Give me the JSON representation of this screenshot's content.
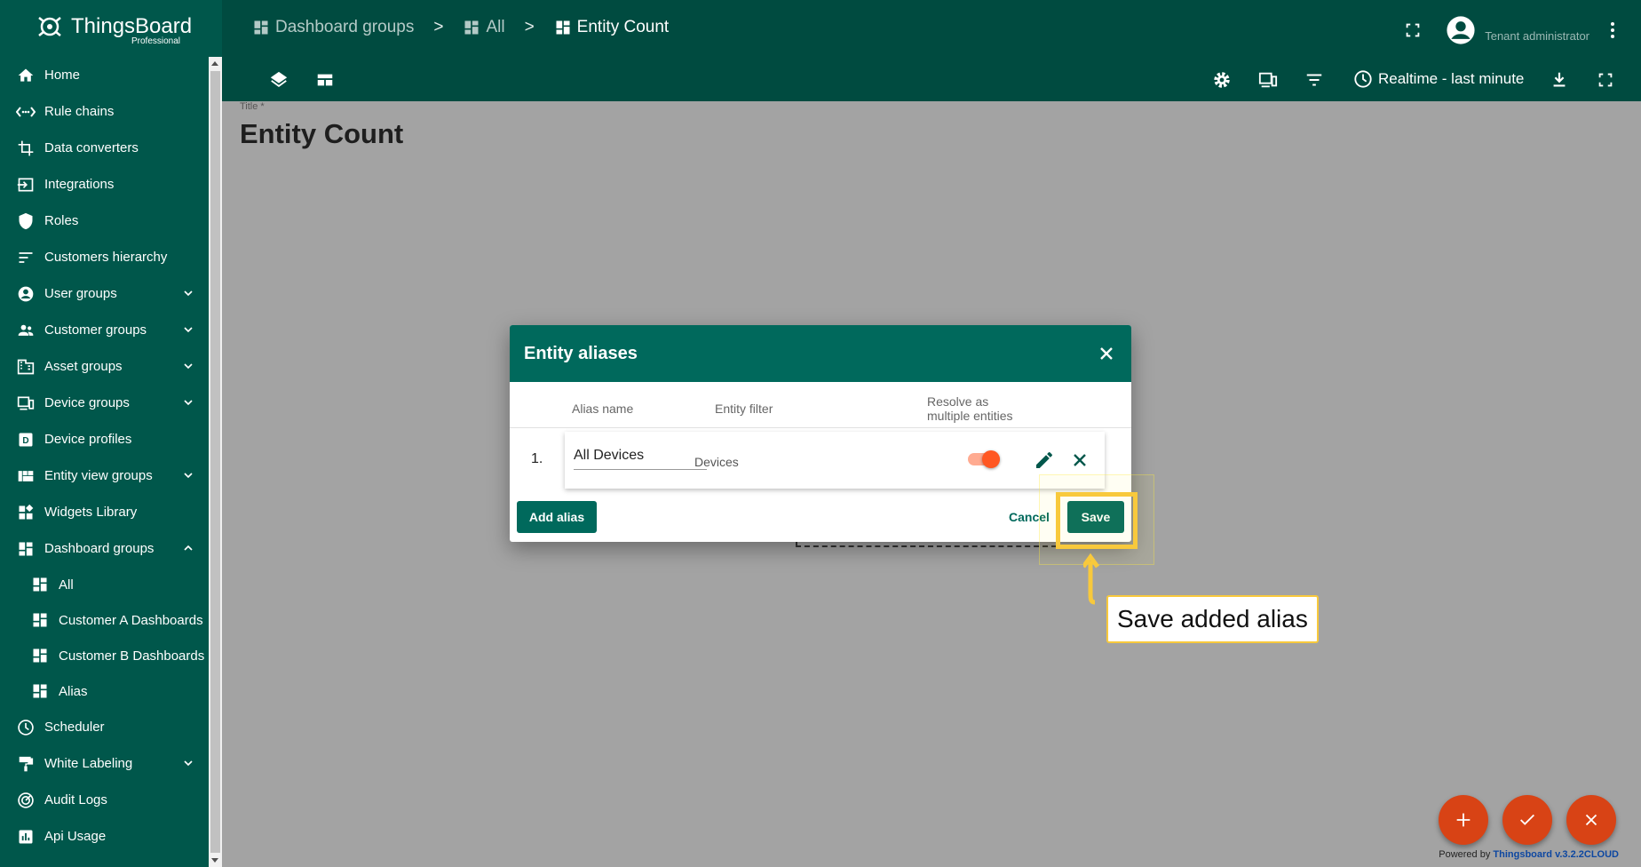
{
  "app": {
    "logo_title": "ThingsBoard",
    "logo_subtitle": "Professional"
  },
  "sidebar": {
    "items": [
      {
        "label": "Home",
        "icon": "home-icon"
      },
      {
        "label": "Rule chains",
        "icon": "rule-chain-icon"
      },
      {
        "label": "Data converters",
        "icon": "converter-icon"
      },
      {
        "label": "Integrations",
        "icon": "integration-icon"
      },
      {
        "label": "Roles",
        "icon": "shield-icon"
      },
      {
        "label": "Customers hierarchy",
        "icon": "hierarchy-icon"
      },
      {
        "label": "User groups",
        "icon": "account-icon"
      },
      {
        "label": "Customer groups",
        "icon": "people-icon"
      },
      {
        "label": "Asset groups",
        "icon": "domain-icon"
      },
      {
        "label": "Device groups",
        "icon": "devices-icon"
      },
      {
        "label": "Device profiles",
        "icon": "device-profile-icon"
      },
      {
        "label": "Entity view groups",
        "icon": "view-quilt-icon"
      },
      {
        "label": "Widgets Library",
        "icon": "widgets-icon"
      },
      {
        "label": "Dashboard groups",
        "icon": "dashboard-icon"
      },
      {
        "label": "All",
        "icon": "dashboard-icon"
      },
      {
        "label": "Customer A Dashboards",
        "icon": "dashboard-icon"
      },
      {
        "label": "Customer B Dashboards",
        "icon": "dashboard-icon"
      },
      {
        "label": "Alias",
        "icon": "dashboard-icon"
      },
      {
        "label": "Scheduler",
        "icon": "clock-icon"
      },
      {
        "label": "White Labeling",
        "icon": "format-paint-icon"
      },
      {
        "label": "Audit Logs",
        "icon": "track-changes-icon"
      },
      {
        "label": "Api Usage",
        "icon": "insert-chart-icon"
      }
    ]
  },
  "header": {
    "breadcrumbs": [
      "Dashboard groups",
      "All",
      "Entity Count"
    ],
    "separator": ">",
    "user_role": "Tenant administrator",
    "timewindow": "Realtime - last minute"
  },
  "page": {
    "title_label": "Title *",
    "title": "Entity Count"
  },
  "dialog": {
    "title": "Entity aliases",
    "columns": {
      "alias_name": "Alias name",
      "entity_filter": "Entity filter",
      "resolve_line1": "Resolve as",
      "resolve_line2": "multiple entities"
    },
    "rows": [
      {
        "num": "1.",
        "alias": "All Devices",
        "filter": "Devices",
        "resolve_multiple": true
      }
    ],
    "add_alias": "Add alias",
    "cancel": "Cancel",
    "save": "Save"
  },
  "callout": {
    "text": "Save added alias"
  },
  "footer": {
    "powered_prefix": "Powered by ",
    "powered_link": "Thingsboard v.3.2.2CLOUD"
  },
  "colors": {
    "primary": "#00695c",
    "sidebar": "#00574b",
    "accent": "#d84315",
    "highlight": "#f8c93c"
  }
}
